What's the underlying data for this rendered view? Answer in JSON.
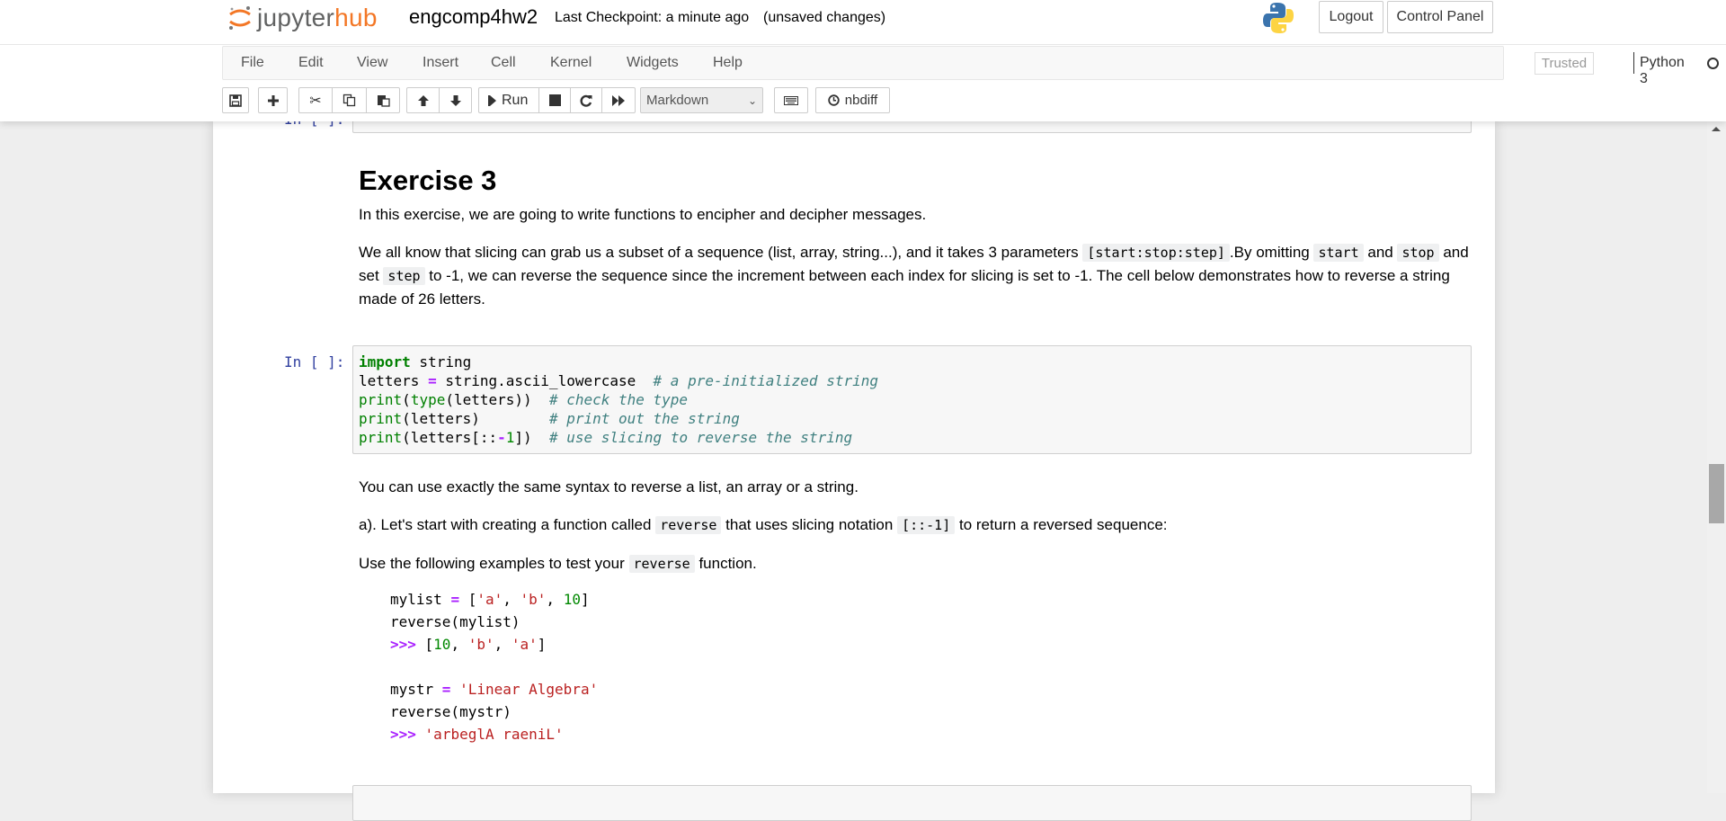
{
  "header": {
    "logo_part1": "jupyter",
    "logo_part2": "hub",
    "notebook_name": "engcomp4hw2",
    "checkpoint": "Last Checkpoint: a minute ago",
    "autosave_status": "(unsaved changes)",
    "logout_label": "Logout",
    "control_panel_label": "Control Panel"
  },
  "menubar": {
    "items": [
      "File",
      "Edit",
      "View",
      "Insert",
      "Cell",
      "Kernel",
      "Widgets",
      "Help"
    ],
    "trusted_label": "Trusted",
    "kernel_name": "Python 3"
  },
  "toolbar": {
    "buttons": [
      {
        "name": "save",
        "icon": "floppy-icon"
      },
      {
        "name": "insert-cell-below",
        "icon": "plus-icon"
      },
      {
        "name": "cut",
        "icon": "scissors-icon"
      },
      {
        "name": "copy",
        "icon": "copy-icon"
      },
      {
        "name": "paste",
        "icon": "paste-icon"
      },
      {
        "name": "move-up",
        "icon": "arrow-up-icon"
      },
      {
        "name": "move-down",
        "icon": "arrow-down-icon"
      },
      {
        "name": "run",
        "icon": "step-forward-icon",
        "label": "Run"
      },
      {
        "name": "interrupt",
        "icon": "stop-icon"
      },
      {
        "name": "restart",
        "icon": "refresh-icon"
      },
      {
        "name": "restart-run-all",
        "icon": "fast-forward-icon"
      }
    ],
    "run_label": "Run",
    "cell_type": "Markdown",
    "keyboard_icon": "keyboard-icon",
    "nbdiff_label": "nbdiff"
  },
  "cells": {
    "prev_prompt": "In [ ]:",
    "heading": "Exercise 3",
    "intro": "In this exercise, we are going to write functions to encipher and decipher messages.",
    "para2": {
      "t1": "We all know that slicing can grab us a subset of a sequence (list, array, string...), and it takes 3 parameters",
      "c1": "[start:stop:step]",
      "t2": ".By omitting",
      "c2": "start",
      "t3": "and",
      "c3": "stop",
      "t4": "and set",
      "c4": "step",
      "t5": "to -1, we can reverse the sequence since the increment between each index for slicing is set to -1. The cell below demonstrates how to reverse a string made of 26 letters."
    },
    "code_prompt": "In [ ]:",
    "code_lines": [
      {
        "kw": "import",
        "rest": " string"
      },
      {
        "a": "letters ",
        "op": "=",
        "b": " string.ascii_lowercase  ",
        "cm": "# a pre-initialized string"
      },
      {
        "bi1": "print",
        "a": "(",
        "bi2": "type",
        "b": "(letters))  ",
        "cm": "# check the type"
      },
      {
        "bi1": "print",
        "a": "(letters)        ",
        "cm": "# print out the string"
      },
      {
        "bi1": "print",
        "a": "(letters[::",
        "op": "-",
        "num": "1",
        "b": "])  ",
        "cm": "# use slicing to reverse the string"
      }
    ],
    "para3": "You can use exactly the same syntax to reverse a list, an array or a string.",
    "para4": {
      "t1": "a). Let's start with creating a function called",
      "c1": "reverse",
      "t2": "that uses slicing notation",
      "c2": "[::-1]",
      "t3": "to return a reversed sequence:"
    },
    "para5": {
      "t1": "Use the following examples to test your",
      "c1": "reverse",
      "t2": "function."
    },
    "example": {
      "l1_a": "mylist ",
      "l1_op": "=",
      "l1_b": " [",
      "l1_s1": "'a'",
      "l1_c": ", ",
      "l1_s2": "'b'",
      "l1_d": ", ",
      "l1_n": "10",
      "l1_e": "]",
      "l2": "reverse(mylist)",
      "l3_p": ">>>",
      "l3_a": " [",
      "l3_n": "10",
      "l3_b": ", ",
      "l3_s1": "'b'",
      "l3_c": ", ",
      "l3_s2": "'a'",
      "l3_d": "]",
      "l5_a": "mystr ",
      "l5_op": "=",
      "l5_sp": " ",
      "l5_s": "'Linear Algebra'",
      "l6": "reverse(mystr)",
      "l7_p": ">>>",
      "l7_sp": " ",
      "l7_s": "'arbeglA raeniL'"
    }
  },
  "scrollbar": {
    "position_fraction": 0.42
  }
}
